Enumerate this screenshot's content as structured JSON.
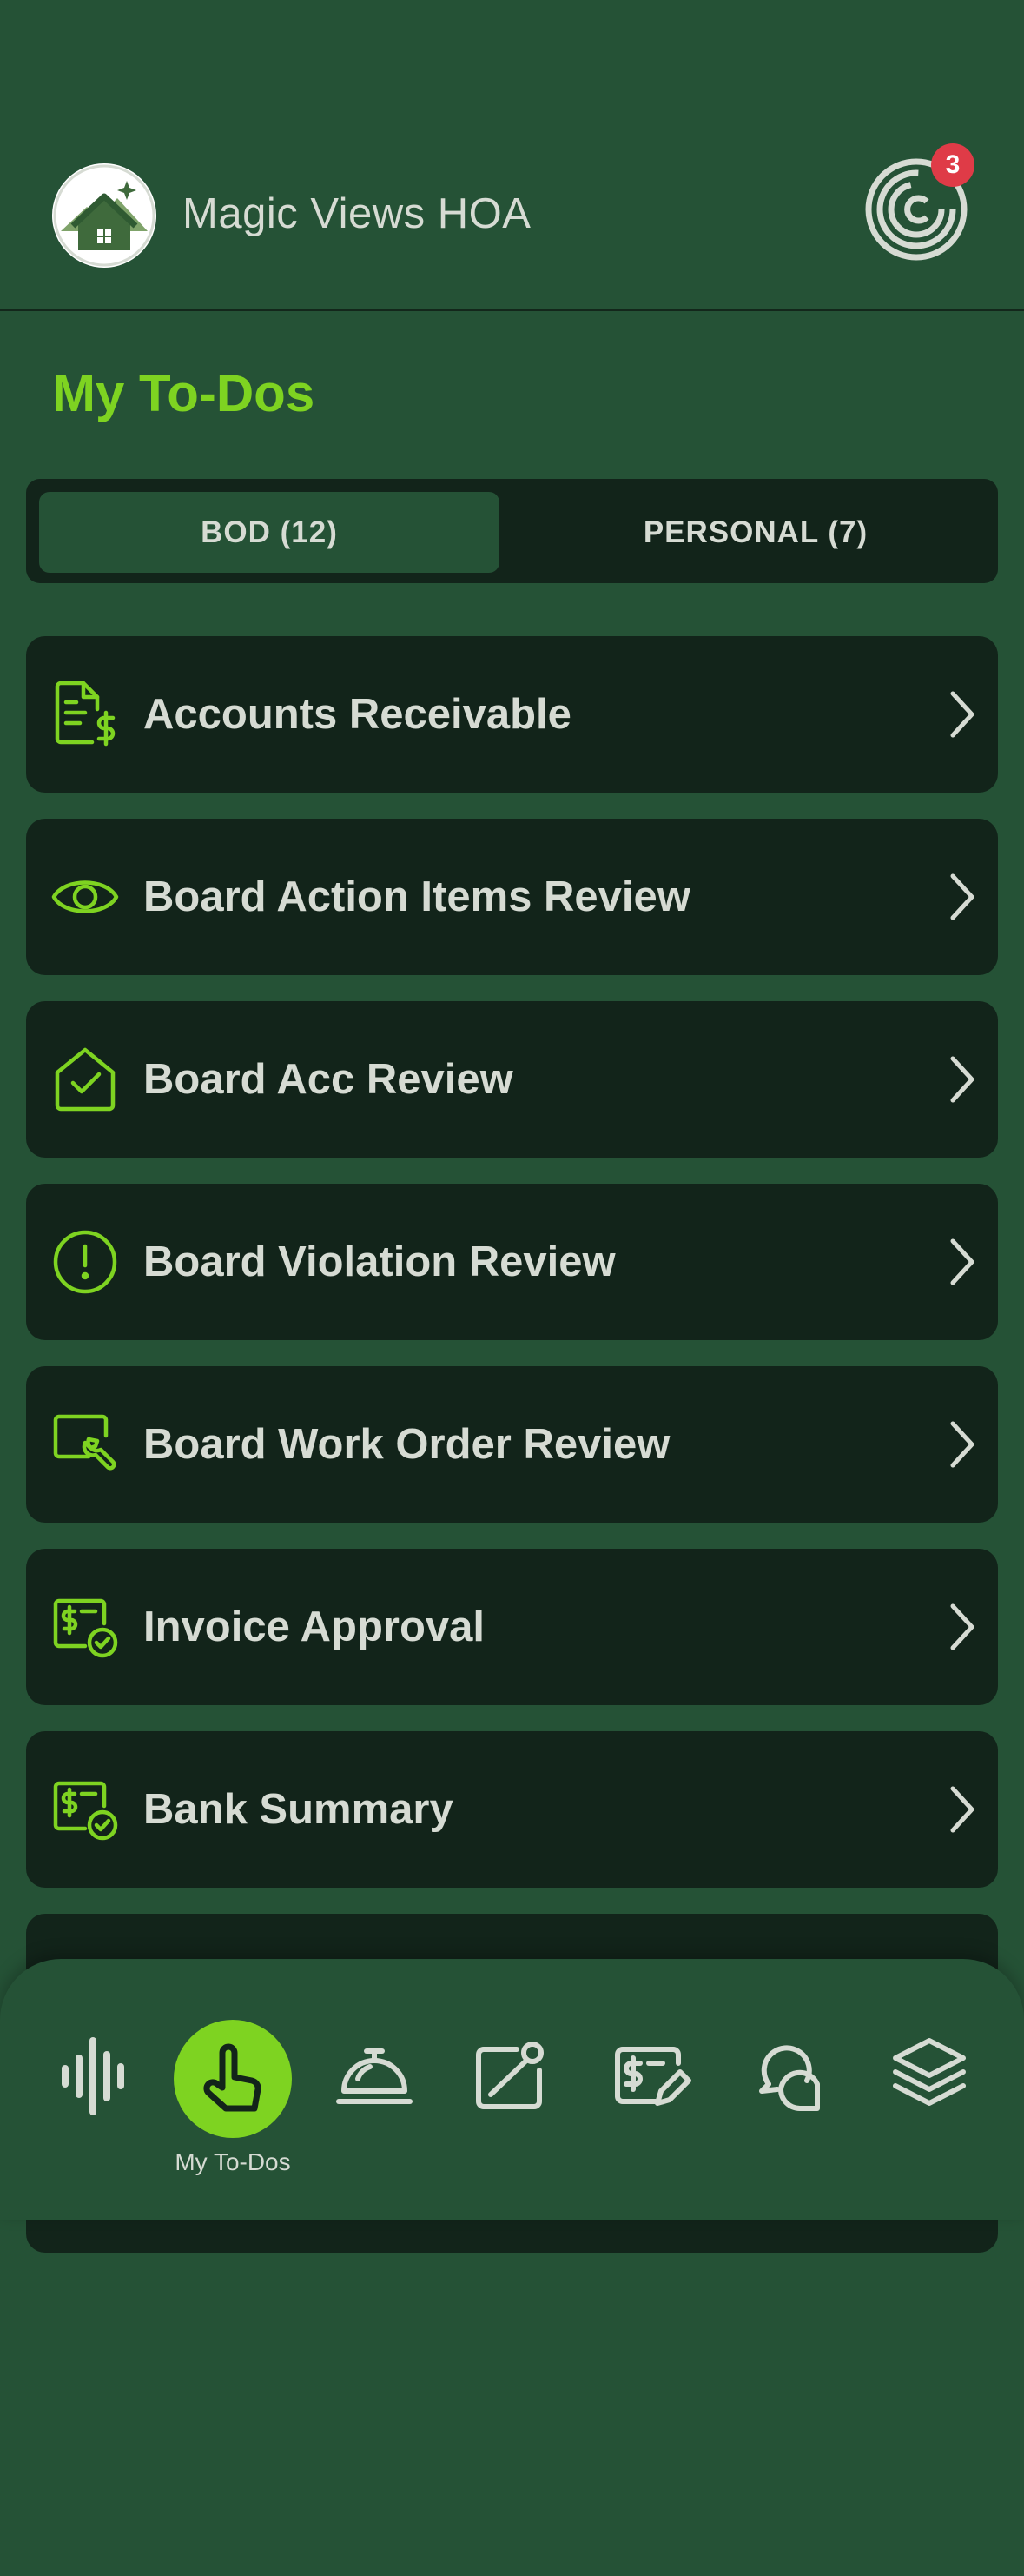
{
  "header": {
    "app_title": "Magic Views HOA",
    "logo_icon": "house-logo-icon",
    "notification_icon": "spiral-notification-icon",
    "notification_count": "3"
  },
  "page": {
    "title": "My To-Dos"
  },
  "tabs": [
    {
      "label": "BOD (12)",
      "active": true
    },
    {
      "label": "PERSONAL (7)",
      "active": false
    }
  ],
  "todo_items": [
    {
      "label": "Accounts Receivable",
      "icon": "receipt-dollar-icon"
    },
    {
      "label": "Board Action Items Review",
      "icon": "eye-icon"
    },
    {
      "label": "Board Acc Review",
      "icon": "house-check-icon"
    },
    {
      "label": "Board Violation Review",
      "icon": "exclamation-circle-icon"
    },
    {
      "label": "Board Work Order Review",
      "icon": "wrench-screen-icon"
    },
    {
      "label": "Invoice Approval",
      "icon": "invoice-check-icon"
    },
    {
      "label": "Bank Summary",
      "icon": "invoice-check-icon"
    }
  ],
  "bottom_nav": {
    "items": [
      {
        "icon": "audio-waveform-icon"
      },
      {
        "icon": "pointing-hand-icon",
        "label": "My To-Dos",
        "active": true
      },
      {
        "icon": "service-bell-icon"
      },
      {
        "icon": "notice-board-icon"
      },
      {
        "icon": "invoice-edit-icon"
      },
      {
        "icon": "chat-bubbles-icon"
      },
      {
        "icon": "layers-icon"
      }
    ]
  },
  "colors": {
    "background": "#255236",
    "card": "#12241a",
    "accent": "#7ed321",
    "text": "#d6dbd3",
    "badge": "#df3b47"
  }
}
